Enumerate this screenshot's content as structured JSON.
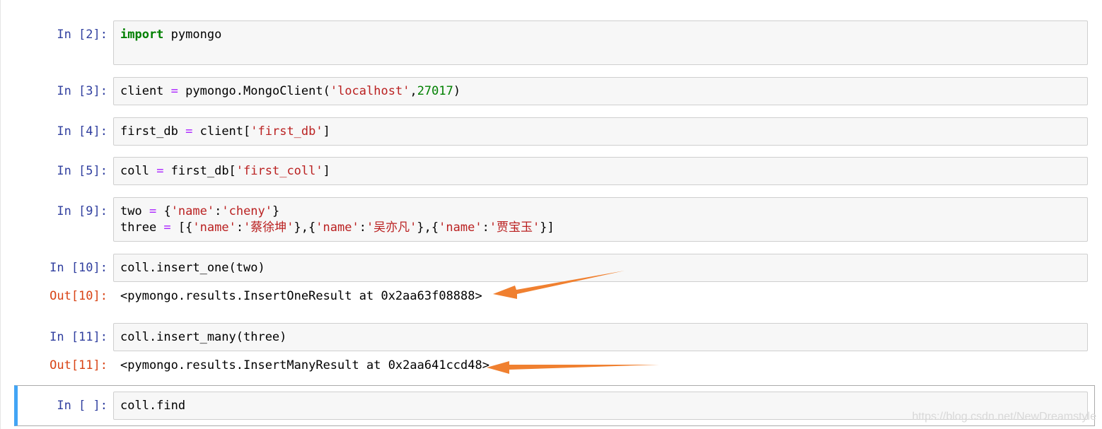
{
  "cells": [
    {
      "prompt": "In  [2]:",
      "code_lines": [
        [
          {
            "t": "import",
            "c": "kw"
          },
          {
            "t": " pymongo",
            "c": ""
          }
        ]
      ]
    },
    {
      "prompt": "In  [3]:",
      "code_lines": [
        [
          {
            "t": "client ",
            "c": ""
          },
          {
            "t": "=",
            "c": "op"
          },
          {
            "t": " pymongo.MongoClient(",
            "c": ""
          },
          {
            "t": "'localhost'",
            "c": "str"
          },
          {
            "t": ",",
            "c": ""
          },
          {
            "t": "27017",
            "c": "num"
          },
          {
            "t": ")",
            "c": ""
          }
        ]
      ]
    },
    {
      "prompt": "In  [4]:",
      "code_lines": [
        [
          {
            "t": "first_db ",
            "c": ""
          },
          {
            "t": "=",
            "c": "op"
          },
          {
            "t": " client[",
            "c": ""
          },
          {
            "t": "'first_db'",
            "c": "str"
          },
          {
            "t": "]",
            "c": ""
          }
        ]
      ]
    },
    {
      "prompt": "In  [5]:",
      "code_lines": [
        [
          {
            "t": "coll ",
            "c": ""
          },
          {
            "t": "=",
            "c": "op"
          },
          {
            "t": " first_db[",
            "c": ""
          },
          {
            "t": "'first_coll'",
            "c": "str"
          },
          {
            "t": "]",
            "c": ""
          }
        ]
      ]
    },
    {
      "prompt": "In  [9]:",
      "code_lines": [
        [
          {
            "t": "two ",
            "c": ""
          },
          {
            "t": "=",
            "c": "op"
          },
          {
            "t": " {",
            "c": ""
          },
          {
            "t": "'name'",
            "c": "str"
          },
          {
            "t": ":",
            "c": ""
          },
          {
            "t": "'cheny'",
            "c": "str"
          },
          {
            "t": "}",
            "c": ""
          }
        ],
        [
          {
            "t": "three ",
            "c": ""
          },
          {
            "t": "=",
            "c": "op"
          },
          {
            "t": " [{",
            "c": ""
          },
          {
            "t": "'name'",
            "c": "str"
          },
          {
            "t": ":",
            "c": ""
          },
          {
            "t": "'蔡徐坤'",
            "c": "str"
          },
          {
            "t": "},{",
            "c": ""
          },
          {
            "t": "'name'",
            "c": "str"
          },
          {
            "t": ":",
            "c": ""
          },
          {
            "t": "'吴亦凡'",
            "c": "str"
          },
          {
            "t": "},{",
            "c": ""
          },
          {
            "t": "'name'",
            "c": "str"
          },
          {
            "t": ":",
            "c": ""
          },
          {
            "t": "'贾宝玉'",
            "c": "str"
          },
          {
            "t": "}]",
            "c": ""
          }
        ]
      ]
    },
    {
      "prompt": "In  [10]:",
      "code_lines": [
        [
          {
            "t": "coll.insert_one(two)",
            "c": ""
          }
        ]
      ],
      "out_prompt": "Out[10]:",
      "output": "<pymongo.results.InsertOneResult at 0x2aa63f08888>"
    },
    {
      "prompt": "In  [11]:",
      "code_lines": [
        [
          {
            "t": "coll.insert_many(three)",
            "c": ""
          }
        ]
      ],
      "out_prompt": "Out[11]:",
      "output": "<pymongo.results.InsertManyResult at 0x2aa641ccd48>"
    },
    {
      "prompt": "In  [ ]:",
      "code_lines": [
        [
          {
            "t": "coll.find",
            "c": ""
          }
        ]
      ]
    }
  ],
  "annotations": {
    "arrow_color": "#f08030"
  },
  "watermark": "https://blog.csdn.net/NewDreamstyle",
  "colors": {
    "prompt_in": "#303f9f",
    "prompt_out": "#d84315",
    "selected_bar": "#42a5f5",
    "keyword": "#008000",
    "string": "#ba2121",
    "operator": "#aa22ff"
  }
}
